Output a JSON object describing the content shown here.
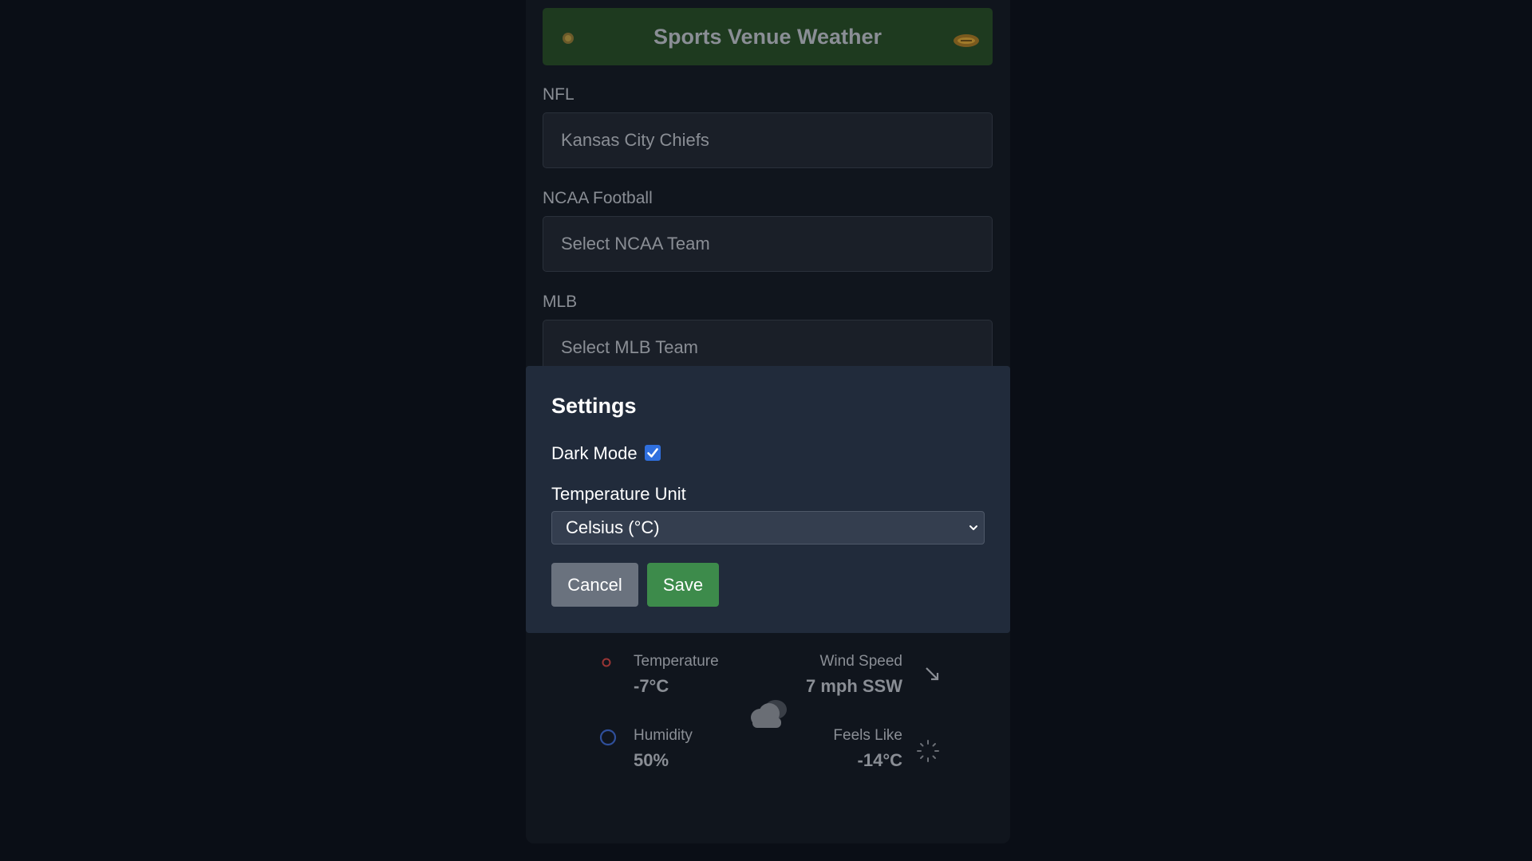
{
  "header": {
    "title": "Sports Venue Weather",
    "left_icon": "sun-icon",
    "right_icon": "football-icon"
  },
  "teams": [
    {
      "label": "NFL",
      "value": "Kansas City Chiefs"
    },
    {
      "label": "NCAA Football",
      "value": "Select NCAA Team"
    },
    {
      "label": "MLB",
      "value": "Select MLB Team"
    }
  ],
  "settings": {
    "title": "Settings",
    "dark_mode_label": "Dark Mode",
    "dark_mode_checked": true,
    "temp_unit_label": "Temperature Unit",
    "temp_unit_value": "Celsius (°C)",
    "cancel_label": "Cancel",
    "save_label": "Save"
  },
  "weather": {
    "temperature_label": "Temperature",
    "temperature_value": "-7°C",
    "wind_label": "Wind Speed",
    "wind_value": "7 mph SSW",
    "humidity_label": "Humidity",
    "humidity_value": "50%",
    "feels_like_label": "Feels Like",
    "feels_like_value": "-14°C",
    "condition_icon": "cloud-icon"
  },
  "colors": {
    "header_bg": "#1e3a1f",
    "checkbox_accent": "#2f6fde",
    "save_button": "#3d8b4b",
    "cancel_button": "#6a727e",
    "modal_bg": "#212b3b"
  }
}
